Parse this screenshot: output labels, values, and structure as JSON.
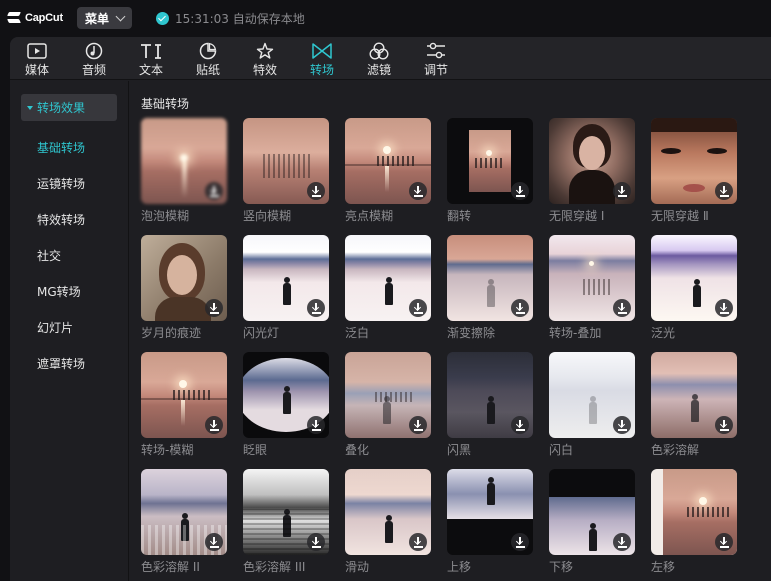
{
  "app": {
    "logo_text": "CapCut",
    "menu_label": "菜单",
    "autosave_text": "15:31:03 自动保存本地"
  },
  "toolbar": {
    "active": "transitions",
    "accent_color": "#2fc6cf",
    "tools": [
      {
        "id": "media",
        "label": "媒体",
        "icon": "media-icon"
      },
      {
        "id": "audio",
        "label": "音频",
        "icon": "audio-icon"
      },
      {
        "id": "text",
        "label": "文本",
        "icon": "text-icon"
      },
      {
        "id": "stickers",
        "label": "贴纸",
        "icon": "sticker-icon"
      },
      {
        "id": "effects",
        "label": "特效",
        "icon": "effects-icon"
      },
      {
        "id": "transitions",
        "label": "转场",
        "icon": "transition-icon"
      },
      {
        "id": "filters",
        "label": "滤镜",
        "icon": "filter-icon"
      },
      {
        "id": "adjust",
        "label": "调节",
        "icon": "adjust-icon"
      }
    ]
  },
  "sidebar": {
    "header": "转场效果",
    "items": [
      {
        "label": "基础转场",
        "active": true
      },
      {
        "label": "运镜转场",
        "active": false
      },
      {
        "label": "特效转场",
        "active": false
      },
      {
        "label": "社交",
        "active": false
      },
      {
        "label": "MG转场",
        "active": false
      },
      {
        "label": "幻灯片",
        "active": false
      },
      {
        "label": "遮罩转场",
        "active": false
      }
    ]
  },
  "content": {
    "section_title": "基础转场",
    "items": [
      {
        "label": "泡泡模糊",
        "art": "blur-sunset"
      },
      {
        "label": "竖向模糊",
        "art": "vertical-blur"
      },
      {
        "label": "亮点模糊",
        "art": "sunset"
      },
      {
        "label": "翻转",
        "art": "flip"
      },
      {
        "label": "无限穿越 Ⅰ",
        "art": "portrait"
      },
      {
        "label": "无限穿越 Ⅱ",
        "art": "closeup"
      },
      {
        "label": "岁月的痕迹",
        "art": "portrait2"
      },
      {
        "label": "闪光灯",
        "art": "lake"
      },
      {
        "label": "泛白",
        "art": "lake"
      },
      {
        "label": "渐变擦除",
        "art": "sunset-lake"
      },
      {
        "label": "转场-叠加",
        "art": "overlay"
      },
      {
        "label": "泛光",
        "art": "bloom"
      },
      {
        "label": "转场-模糊",
        "art": "sunset"
      },
      {
        "label": "眨眼",
        "art": "blink"
      },
      {
        "label": "叠化",
        "art": "dissolve"
      },
      {
        "label": "闪黑",
        "art": "dark"
      },
      {
        "label": "闪白",
        "art": "white"
      },
      {
        "label": "色彩溶解",
        "art": "color-dissolve"
      },
      {
        "label": "色彩溶解 II",
        "art": "cd2"
      },
      {
        "label": "色彩溶解 III",
        "art": "cd3"
      },
      {
        "label": "滑动",
        "art": "slide"
      },
      {
        "label": "上移",
        "art": "up"
      },
      {
        "label": "下移",
        "art": "down"
      },
      {
        "label": "左移",
        "art": "left"
      }
    ]
  }
}
